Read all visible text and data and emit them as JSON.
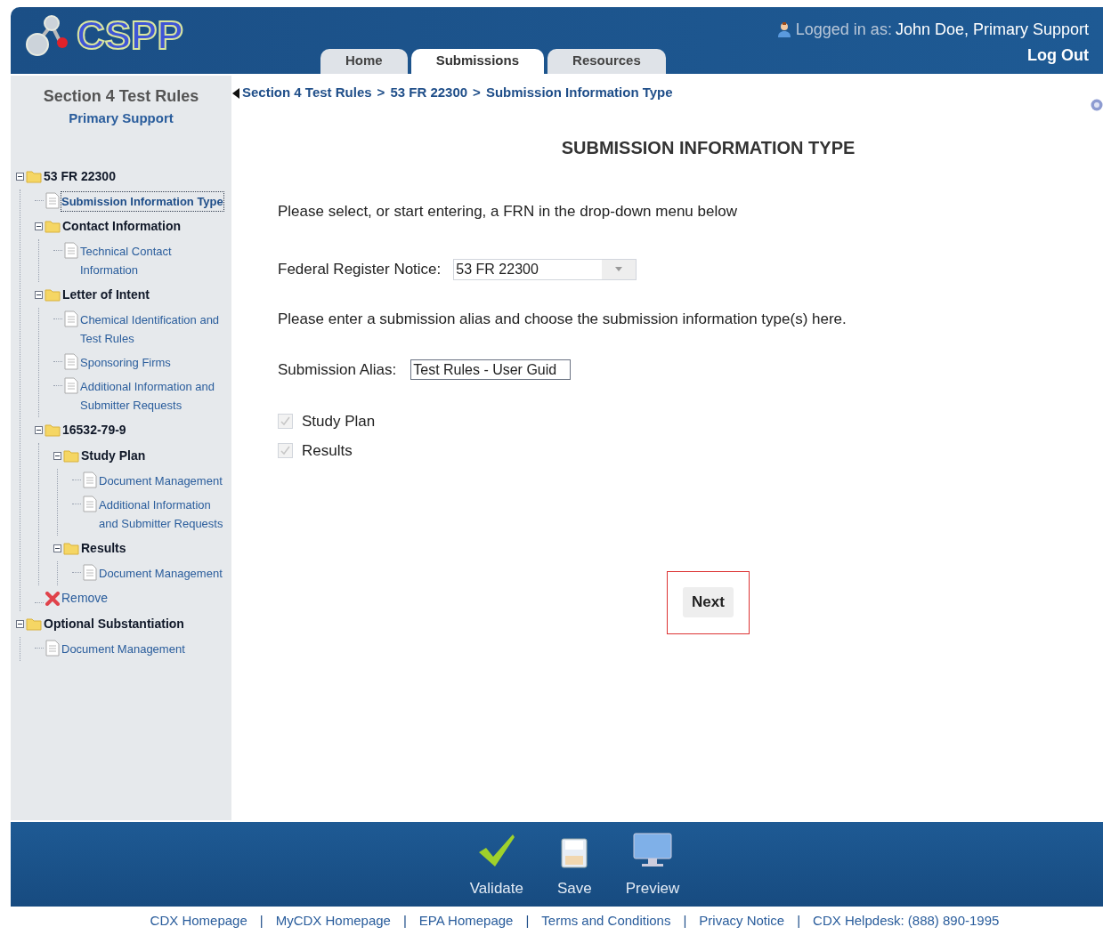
{
  "header": {
    "logo_text": "CSPP",
    "tabs": [
      {
        "label": "Home",
        "selected": false
      },
      {
        "label": "Submissions",
        "selected": true
      },
      {
        "label": "Resources",
        "selected": false
      }
    ],
    "login_label": "Logged in as:",
    "user": "John Doe, Primary Support",
    "logout": "Log Out"
  },
  "sidebar": {
    "title": "Section 4 Test Rules",
    "subtitle": "Primary Support",
    "tree": [
      {
        "kind": "folder",
        "label": "53 FR 22300",
        "selected": false,
        "expanded": true,
        "children": [
          {
            "kind": "document",
            "label": "Submission Information Type",
            "selected": true
          },
          {
            "kind": "folder",
            "label": "Contact Information",
            "selected": false,
            "expanded": true,
            "children": [
              {
                "kind": "document",
                "label": "Technical Contact Information",
                "selected": false
              }
            ]
          },
          {
            "kind": "folder",
            "label": "Letter of Intent",
            "selected": false,
            "expanded": true,
            "children": [
              {
                "kind": "document",
                "label": "Chemical Identification and Test Rules",
                "selected": false
              },
              {
                "kind": "document",
                "label": "Sponsoring Firms",
                "selected": false
              },
              {
                "kind": "document",
                "label": "Additional Information and Submitter Requests",
                "selected": false
              }
            ]
          },
          {
            "kind": "folder",
            "label": "16532-79-9",
            "selected": false,
            "expanded": true,
            "children": [
              {
                "kind": "folder",
                "label": "Study Plan",
                "selected": false,
                "expanded": true,
                "children": [
                  {
                    "kind": "document",
                    "label": "Document Management",
                    "selected": false
                  },
                  {
                    "kind": "document",
                    "label": "Additional Information and Submitter Requests",
                    "selected": false
                  }
                ]
              },
              {
                "kind": "folder",
                "label": "Results",
                "selected": false,
                "expanded": true,
                "children": [
                  {
                    "kind": "document",
                    "label": "Document Management",
                    "selected": false
                  }
                ]
              }
            ]
          },
          {
            "kind": "remove",
            "label": "Remove",
            "selected": false
          }
        ]
      },
      {
        "kind": "folder",
        "label": "Optional Substantiation",
        "selected": false,
        "expanded": true,
        "children": [
          {
            "kind": "document",
            "label": "Document Management",
            "selected": false
          }
        ]
      }
    ]
  },
  "breadcrumb": {
    "items": [
      "Section 4 Test Rules",
      "53 FR 22300",
      "Submission Information Type"
    ],
    "separator": ">"
  },
  "main": {
    "title": "SUBMISSION INFORMATION TYPE",
    "frn_instruction": "Please select, or start entering, a FRN in the drop-down menu below",
    "frn_label": "Federal Register Notice:",
    "frn_value": "53 FR 22300",
    "alias_instruction": "Please enter a submission alias and choose the submission information type(s) here.",
    "alias_label": "Submission Alias:",
    "alias_value": "Test Rules - User Guid",
    "types": [
      {
        "label": "Study Plan",
        "checked": true,
        "disabled": true
      },
      {
        "label": "Results",
        "checked": true,
        "disabled": true
      }
    ],
    "next_button": "Next"
  },
  "toolbar": [
    {
      "kind": "validate",
      "label": "Validate"
    },
    {
      "kind": "save",
      "label": "Save"
    },
    {
      "kind": "preview",
      "label": "Preview"
    }
  ],
  "footer": {
    "separator": "|",
    "links": [
      "CDX Homepage",
      "MyCDX Homepage",
      "EPA Homepage",
      "Terms and Conditions",
      "Privacy Notice",
      "CDX Helpdesk: (888) 890-1995"
    ]
  }
}
